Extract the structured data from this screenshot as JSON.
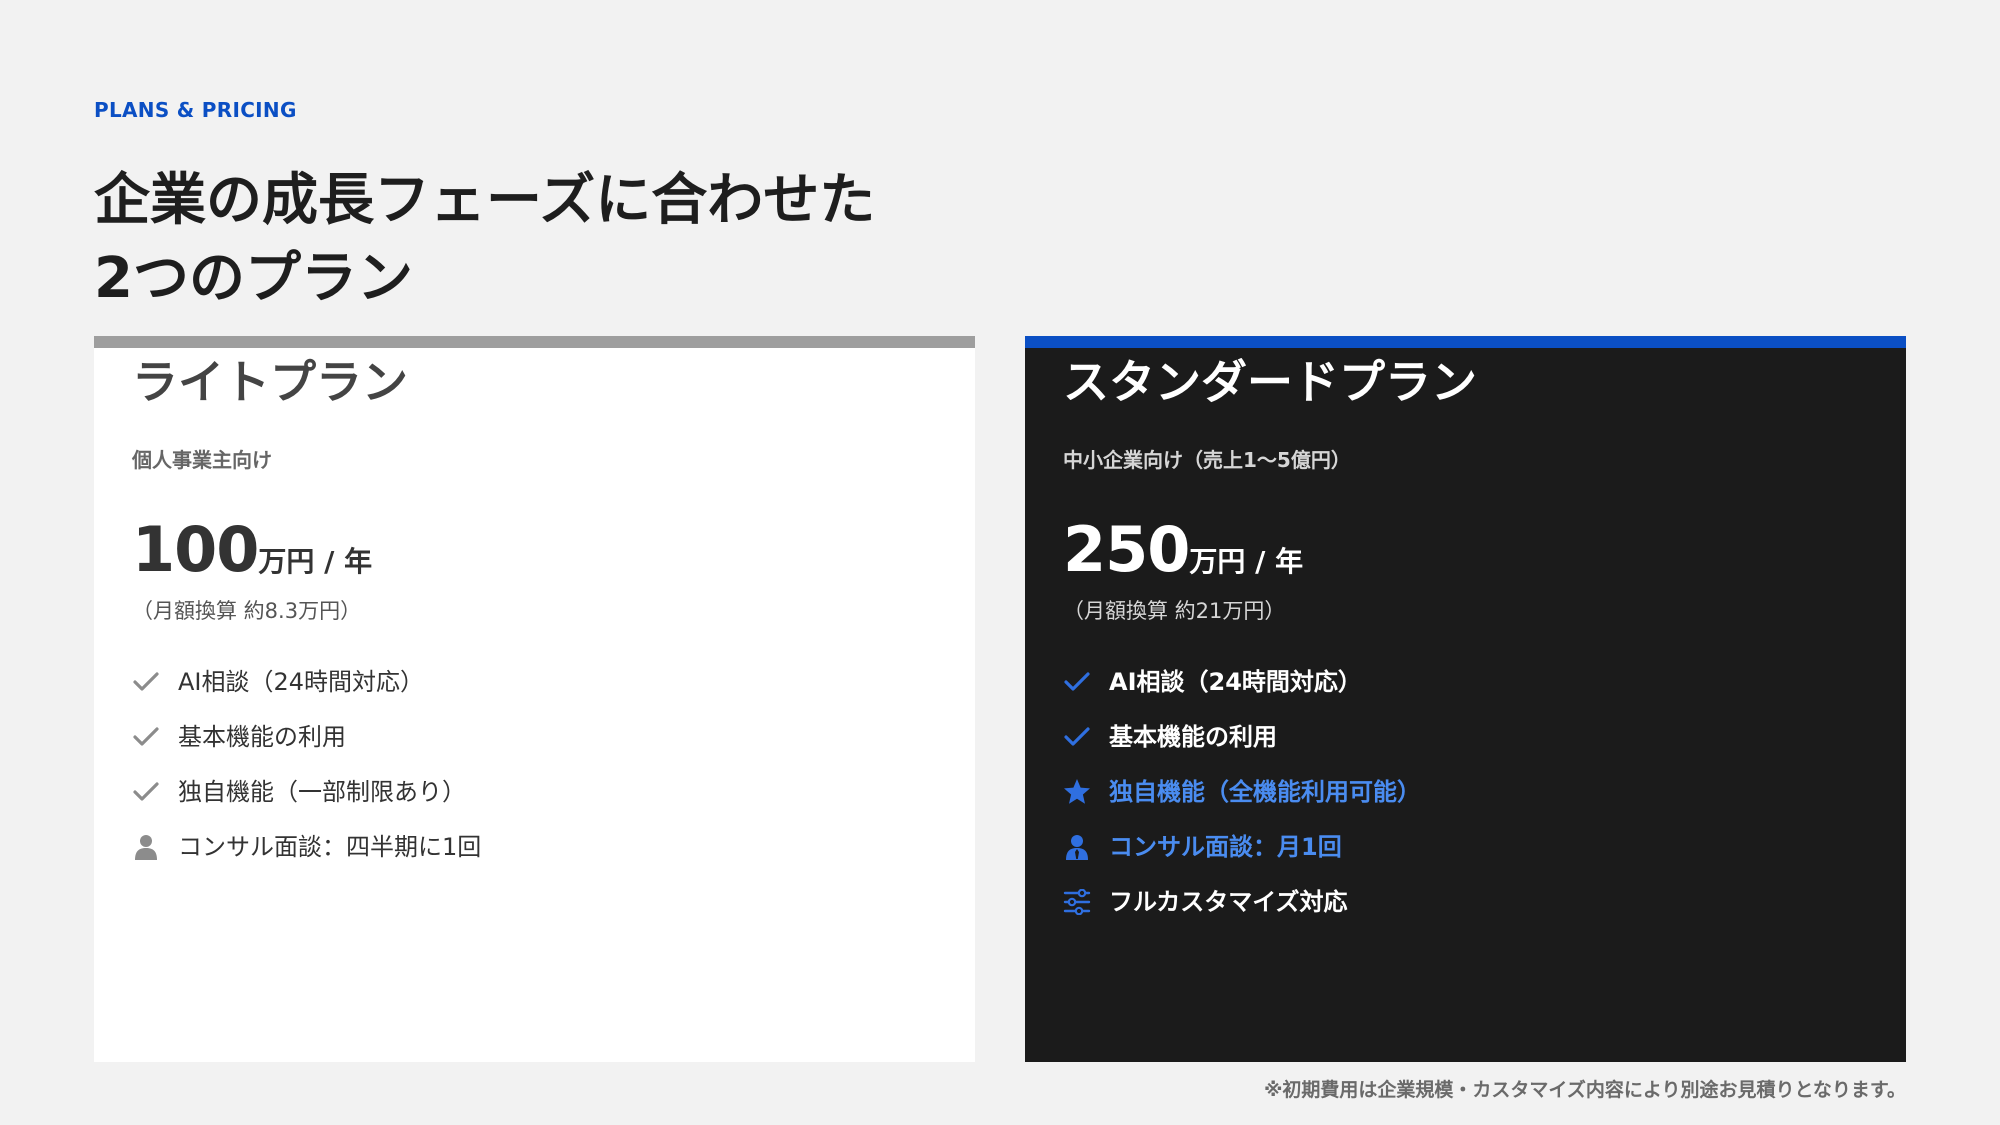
{
  "eyebrow": "PLANS & PRICING",
  "headline": {
    "line1": "企業の成長フェーズに合わせた",
    "line2": "2つのプラン"
  },
  "colors": {
    "accent": "#0b4fc4",
    "highlight": "#4a8cf0",
    "light_card_bar": "#9e9e9e",
    "dark_card_bg": "#1b1b1b",
    "page_bg": "#f2f2f2"
  },
  "plans": [
    {
      "name": "ライトプラン",
      "target": "個人事業主向け",
      "price": "100",
      "unit": "万円 / 年",
      "monthly": "（月額換算 約8.3万円）",
      "features": [
        {
          "icon": "check-icon",
          "label": "AI相談（24時間対応）"
        },
        {
          "icon": "check-icon",
          "label": "基本機能の利用"
        },
        {
          "icon": "check-icon",
          "label": "独自機能（一部制限あり）"
        },
        {
          "icon": "person-icon",
          "label": "コンサル面談：四半期に1回"
        }
      ]
    },
    {
      "name": "スタンダードプラン",
      "target": "中小企業向け（売上1〜5億円）",
      "price": "250",
      "unit": "万円 / 年",
      "monthly": "（月額換算 約21万円）",
      "features": [
        {
          "icon": "check-icon",
          "label": "AI相談（24時間対応）"
        },
        {
          "icon": "check-icon",
          "label": "基本機能の利用"
        },
        {
          "icon": "star-icon",
          "label": "独自機能（全機能利用可能）",
          "highlight": true
        },
        {
          "icon": "user-tie-icon",
          "label": "コンサル面談：月1回",
          "highlight": true
        },
        {
          "icon": "sliders-icon",
          "label": "フルカスタマイズ対応"
        }
      ]
    }
  ],
  "footnote": "※初期費用は企業規模・カスタマイズ内容により別途お見積りとなります。"
}
